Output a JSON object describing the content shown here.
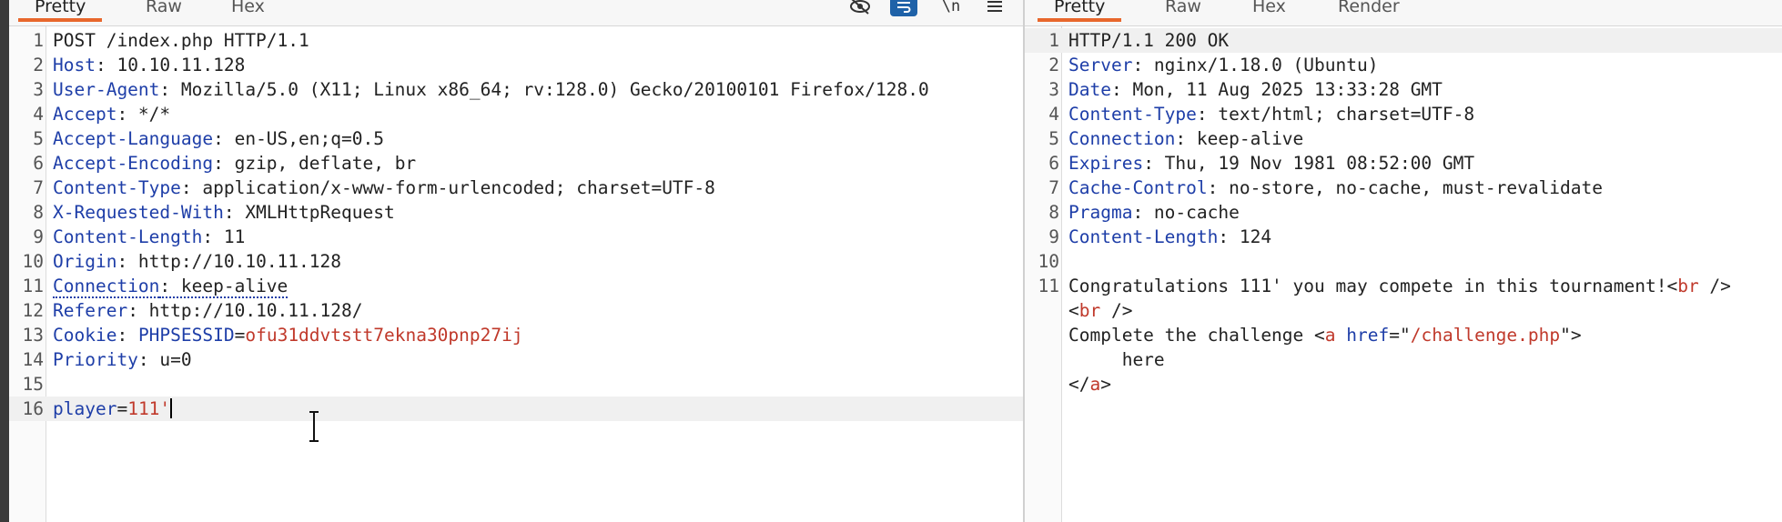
{
  "request": {
    "tabs": [
      {
        "label": "Pretty",
        "active": true
      },
      {
        "label": "Raw"
      },
      {
        "label": "Hex"
      }
    ],
    "toolbar_icons": [
      "eye-slash-icon",
      "wrap-lines-icon",
      "newline-icon",
      "menu-icon"
    ],
    "lines": [
      {
        "n": "1",
        "parts": [
          {
            "t": "POST /index.php HTTP/1.1"
          }
        ]
      },
      {
        "n": "2",
        "parts": [
          {
            "t": "Host",
            "c": "hn"
          },
          {
            "t": ": 10.10.11.128"
          }
        ]
      },
      {
        "n": "3",
        "parts": [
          {
            "t": "User-Agent",
            "c": "hn"
          },
          {
            "t": ": Mozilla/5.0 (X11; Linux x86_64; rv:128.0) Gecko/20100101 Firefox/128.0"
          }
        ]
      },
      {
        "n": "4",
        "parts": [
          {
            "t": "Accept",
            "c": "hn"
          },
          {
            "t": ": */*"
          }
        ]
      },
      {
        "n": "5",
        "parts": [
          {
            "t": "Accept-Language",
            "c": "hn"
          },
          {
            "t": ": en-US,en;q=0.5"
          }
        ]
      },
      {
        "n": "6",
        "parts": [
          {
            "t": "Accept-Encoding",
            "c": "hn"
          },
          {
            "t": ": gzip, deflate, br"
          }
        ]
      },
      {
        "n": "7",
        "parts": [
          {
            "t": "Content-Type",
            "c": "hn"
          },
          {
            "t": ": application/x-www-form-urlencoded; charset=UTF-8"
          }
        ]
      },
      {
        "n": "8",
        "parts": [
          {
            "t": "X-Requested-With",
            "c": "hn"
          },
          {
            "t": ": XMLHttpRequest"
          }
        ]
      },
      {
        "n": "9",
        "parts": [
          {
            "t": "Content-Length",
            "c": "hn"
          },
          {
            "t": ": 11"
          }
        ]
      },
      {
        "n": "10",
        "parts": [
          {
            "t": "Origin",
            "c": "hn"
          },
          {
            "t": ": http://10.10.11.128"
          }
        ]
      },
      {
        "n": "11",
        "parts": [
          {
            "t": "Connection",
            "c": "hn dotted"
          },
          {
            "t": ": keep-alive",
            "c": "dotted"
          }
        ]
      },
      {
        "n": "12",
        "parts": [
          {
            "t": "Referer",
            "c": "hn"
          },
          {
            "t": ": http://10.10.11.128/"
          }
        ]
      },
      {
        "n": "13",
        "parts": [
          {
            "t": "Cookie",
            "c": "hn"
          },
          {
            "t": ": "
          },
          {
            "t": "PHPSESSID",
            "c": "hn"
          },
          {
            "t": "="
          },
          {
            "t": "ofu31ddvtstt7ekna30pnp27ij",
            "c": "pv"
          }
        ]
      },
      {
        "n": "14",
        "parts": [
          {
            "t": "Priority",
            "c": "hn"
          },
          {
            "t": ": u=0"
          }
        ]
      },
      {
        "n": "15",
        "parts": []
      },
      {
        "n": "16",
        "hl": true,
        "caret": true,
        "parts": [
          {
            "t": "player",
            "c": "hn"
          },
          {
            "t": "="
          },
          {
            "t": "111'",
            "c": "pv"
          }
        ]
      }
    ]
  },
  "response": {
    "tabs": [
      {
        "label": "Pretty",
        "active": true
      },
      {
        "label": "Raw"
      },
      {
        "label": "Hex"
      },
      {
        "label": "Render"
      }
    ],
    "lines": [
      {
        "n": "1",
        "hl": true,
        "parts": [
          {
            "t": "HTTP/1.1 200 OK"
          }
        ]
      },
      {
        "n": "2",
        "parts": [
          {
            "t": "Server",
            "c": "hn"
          },
          {
            "t": ": nginx/1.18.0 (Ubuntu)"
          }
        ]
      },
      {
        "n": "3",
        "parts": [
          {
            "t": "Date",
            "c": "hn"
          },
          {
            "t": ": Mon, 11 Aug 2025 13:33:28 GMT"
          }
        ]
      },
      {
        "n": "4",
        "parts": [
          {
            "t": "Content-Type",
            "c": "hn"
          },
          {
            "t": ": text/html; charset=UTF-8"
          }
        ]
      },
      {
        "n": "5",
        "parts": [
          {
            "t": "Connection",
            "c": "hn"
          },
          {
            "t": ": keep-alive"
          }
        ]
      },
      {
        "n": "6",
        "parts": [
          {
            "t": "Expires",
            "c": "hn"
          },
          {
            "t": ": Thu, 19 Nov 1981 08:52:00 GMT"
          }
        ]
      },
      {
        "n": "7",
        "parts": [
          {
            "t": "Cache-Control",
            "c": "hn"
          },
          {
            "t": ": no-store, no-cache, must-revalidate"
          }
        ]
      },
      {
        "n": "8",
        "parts": [
          {
            "t": "Pragma",
            "c": "hn"
          },
          {
            "t": ": no-cache"
          }
        ]
      },
      {
        "n": "9",
        "parts": [
          {
            "t": "Content-Length",
            "c": "hn"
          },
          {
            "t": ": 124"
          }
        ]
      },
      {
        "n": "10",
        "parts": []
      },
      {
        "n": "11",
        "parts": [
          {
            "t": "Congratulations 111' you may compete in this tournament!"
          },
          {
            "t": "<"
          },
          {
            "t": "br",
            "c": "tg"
          },
          {
            "t": " />"
          }
        ]
      },
      {
        "n": "",
        "parts": [
          {
            "t": "<"
          },
          {
            "t": "br",
            "c": "tg"
          },
          {
            "t": " />"
          }
        ]
      },
      {
        "n": "",
        "parts": [
          {
            "t": "Complete the challenge "
          },
          {
            "t": "<"
          },
          {
            "t": "a",
            "c": "tg"
          },
          {
            "t": " "
          },
          {
            "t": "href",
            "c": "an"
          },
          {
            "t": "=\""
          },
          {
            "t": "/challenge.php",
            "c": "pv"
          },
          {
            "t": "\">"
          }
        ]
      },
      {
        "n": "",
        "parts": [
          {
            "t": "     here"
          }
        ]
      },
      {
        "n": "",
        "parts": [
          {
            "t": "</"
          },
          {
            "t": "a",
            "c": "tg"
          },
          {
            "t": ">"
          }
        ]
      }
    ]
  }
}
